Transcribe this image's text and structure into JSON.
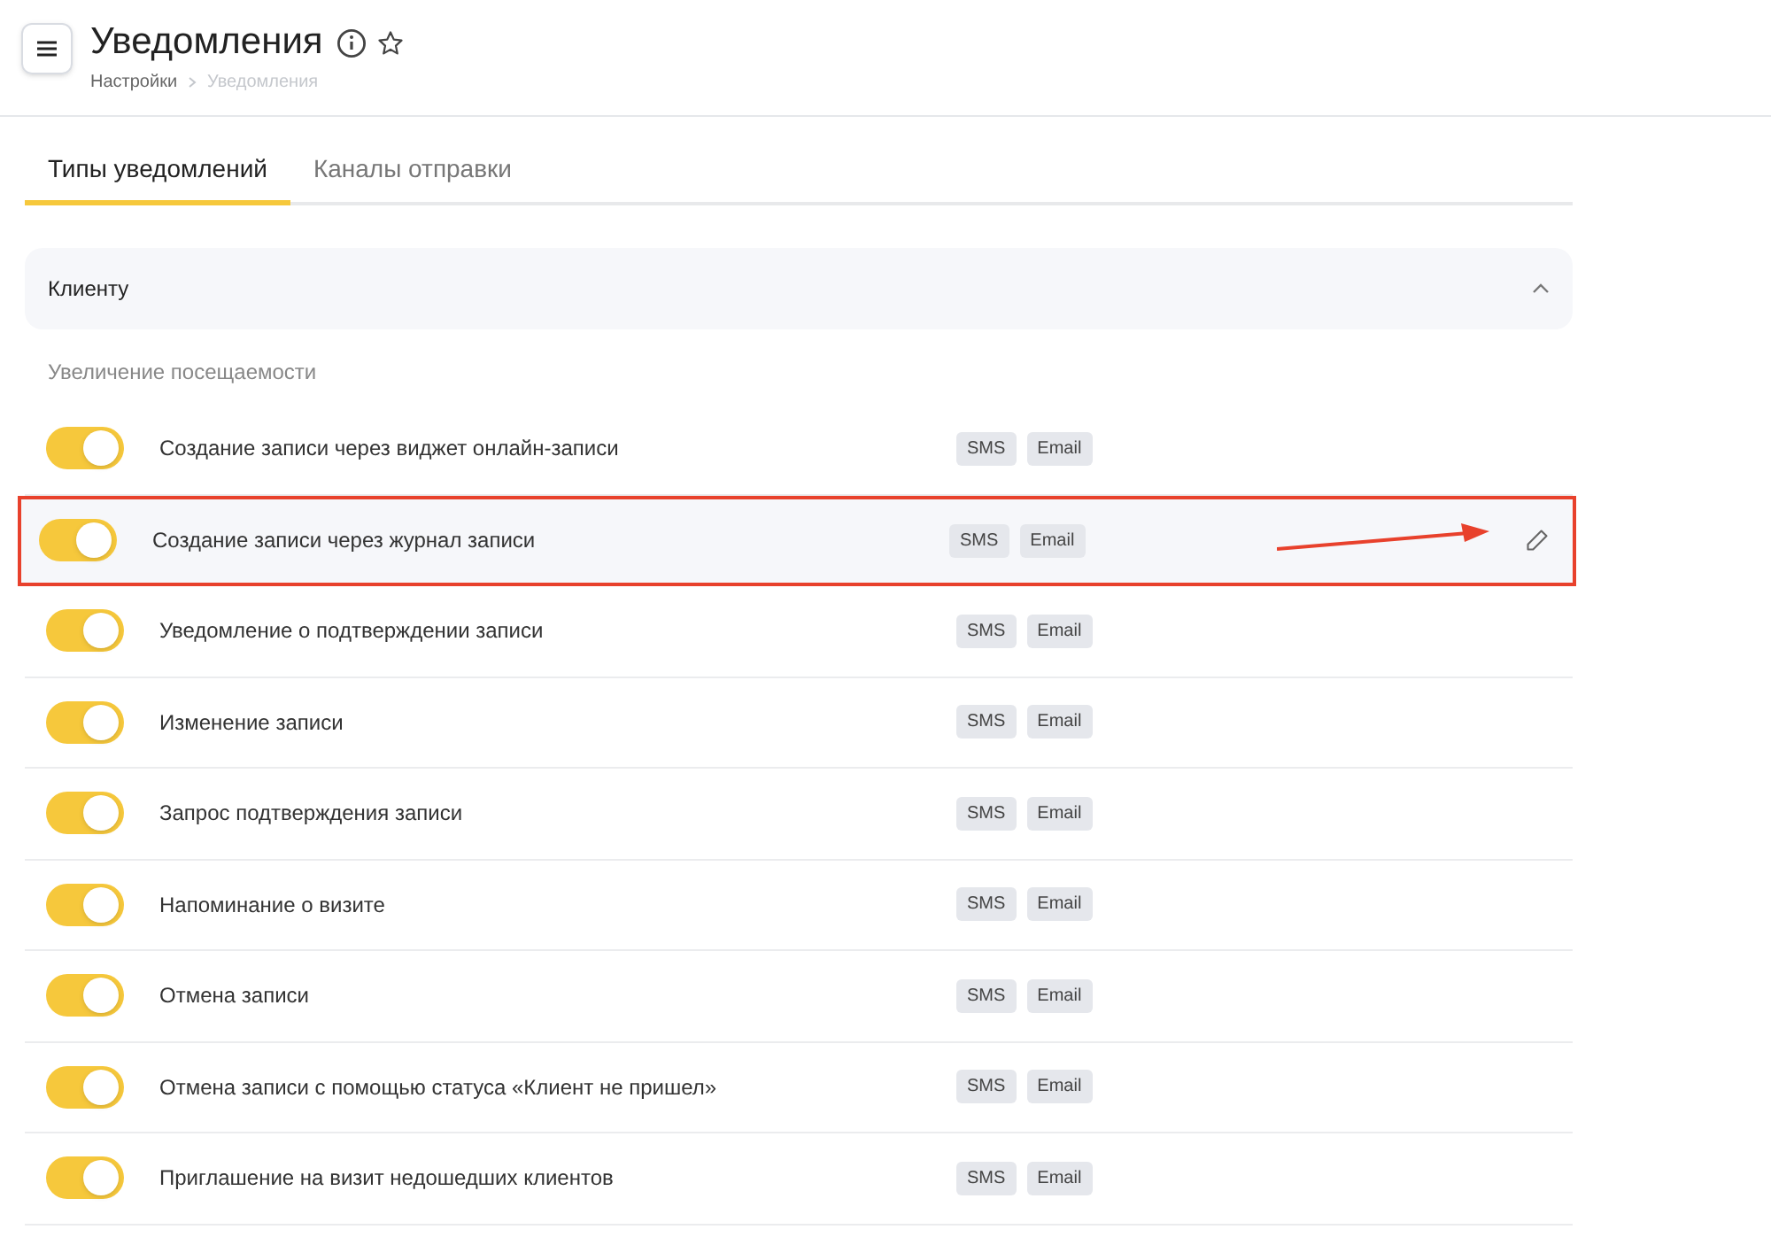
{
  "header": {
    "title": "Уведомления",
    "breadcrumbs": [
      {
        "label": "Настройки",
        "current": false
      },
      {
        "label": "Уведомления",
        "current": true
      }
    ]
  },
  "tabs": [
    {
      "label": "Типы уведомлений",
      "selected": true
    },
    {
      "label": "Каналы отправки",
      "selected": false
    }
  ],
  "section": {
    "title": "Клиенту",
    "expanded": true,
    "group": "Увеличение посещаемости",
    "rows": [
      {
        "label": "Создание записи через виджет онлайн-записи",
        "on": true,
        "channels": [
          "SMS",
          "Email"
        ],
        "highlighted": false
      },
      {
        "label": "Создание записи через журнал записи",
        "on": true,
        "channels": [
          "SMS",
          "Email"
        ],
        "highlighted": true
      },
      {
        "label": "Уведомление о подтверждении записи",
        "on": true,
        "channels": [
          "SMS",
          "Email"
        ],
        "highlighted": false
      },
      {
        "label": "Изменение записи",
        "on": true,
        "channels": [
          "SMS",
          "Email"
        ],
        "highlighted": false
      },
      {
        "label": "Запрос подтверждения записи",
        "on": true,
        "channels": [
          "SMS",
          "Email"
        ],
        "highlighted": false
      },
      {
        "label": "Напоминание о визите",
        "on": true,
        "channels": [
          "SMS",
          "Email"
        ],
        "highlighted": false
      },
      {
        "label": "Отмена записи",
        "on": true,
        "channels": [
          "SMS",
          "Email"
        ],
        "highlighted": false
      },
      {
        "label": "Отмена записи с помощью статуса «Клиент не пришел»",
        "on": true,
        "channels": [
          "SMS",
          "Email"
        ],
        "highlighted": false
      },
      {
        "label": "Приглашение на визит недошедших клиентов",
        "on": true,
        "channels": [
          "SMS",
          "Email"
        ],
        "highlighted": false
      }
    ]
  }
}
